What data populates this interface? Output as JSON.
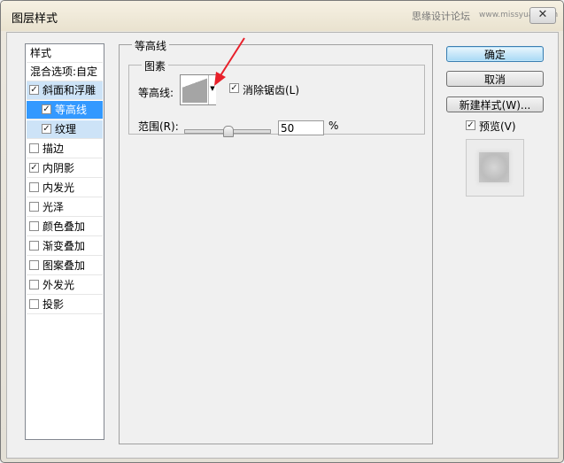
{
  "window": {
    "title": "图层样式",
    "watermark": "思缘设计论坛",
    "watermark_url": "www.missyuan.com",
    "close_label": "✕"
  },
  "styles_list": {
    "header": "样式",
    "blend_options": "混合选项:自定",
    "items": [
      {
        "label": "斜面和浮雕",
        "checked": true
      },
      {
        "label": "等高线",
        "checked": true
      },
      {
        "label": "纹理",
        "checked": true
      },
      {
        "label": "描边",
        "checked": false
      },
      {
        "label": "内阴影",
        "checked": true
      },
      {
        "label": "内发光",
        "checked": false
      },
      {
        "label": "光泽",
        "checked": false
      },
      {
        "label": "颜色叠加",
        "checked": false
      },
      {
        "label": "渐变叠加",
        "checked": false
      },
      {
        "label": "图案叠加",
        "checked": false
      },
      {
        "label": "外发光",
        "checked": false
      },
      {
        "label": "投影",
        "checked": false
      }
    ]
  },
  "panel": {
    "title": "等高线",
    "group_title": "图素",
    "contour_label": "等高线:",
    "anti_alias_label": "消除锯齿(L)",
    "anti_alias_checked": true,
    "range_label": "范围(R):",
    "range_value": "50",
    "range_unit": "%",
    "range_fraction": 0.5
  },
  "buttons": {
    "ok": "确定",
    "cancel": "取消",
    "new_style": "新建样式(W)...",
    "preview_label": "预览(V)",
    "preview_checked": true
  },
  "colors": {
    "selection_dark": "#3399ff",
    "selection_light": "#cde3f7",
    "annotation_arrow": "#e8202a"
  }
}
